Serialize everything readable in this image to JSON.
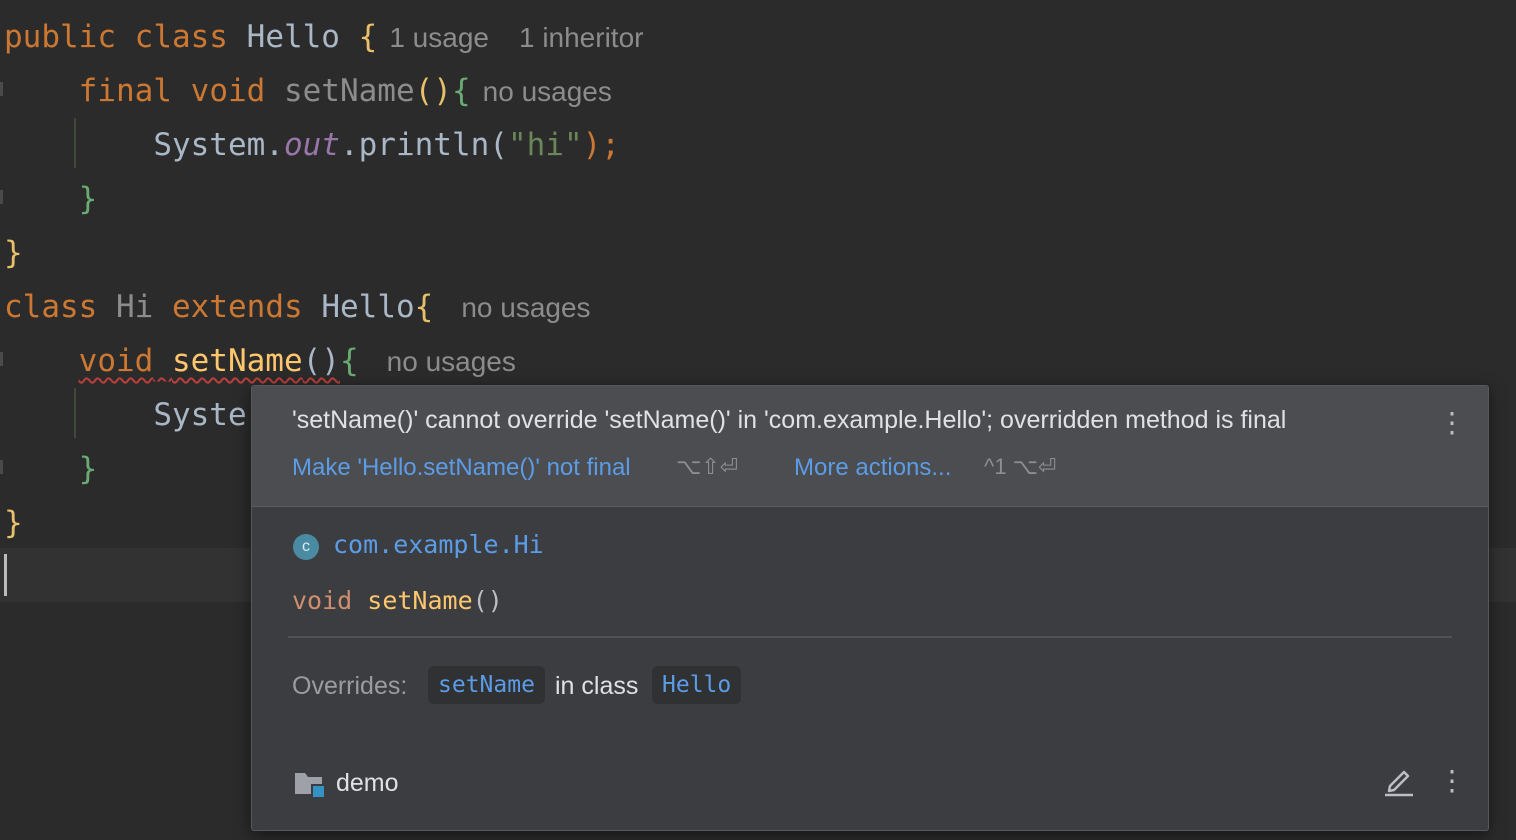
{
  "editor": {
    "line1": {
      "kw1": "public",
      "kw2": "class",
      "name": "Hello",
      "brace": "{",
      "hint1": "1 usage",
      "hint2": "1 inheritor"
    },
    "line2": {
      "kw1": "final",
      "kw2": "void",
      "fn": "setName",
      "parens": "()",
      "brace": "{",
      "hint": "no usages"
    },
    "line3": {
      "obj": "System.",
      "field": "out",
      "call": ".println(",
      "str": "\"hi\"",
      "end": ");"
    },
    "line4": {
      "brace": "}"
    },
    "line5": {
      "brace": "}"
    },
    "line6": {
      "kw1": "class",
      "name": "Hi",
      "kw2": "extends",
      "parent": "Hello",
      "brace": "{",
      "hint": "no usages"
    },
    "line7": {
      "kw": "void",
      "fn": "setName",
      "parens": "()",
      "brace": "{",
      "hint": "no usages"
    },
    "line8": {
      "text": "Syste"
    },
    "line9": {
      "brace": "}"
    },
    "line10": {
      "brace": "}"
    }
  },
  "popup": {
    "error_message": "'setName()' cannot override 'setName()' in 'com.example.Hello'; overridden method is final",
    "quick_fix_label": "Make 'Hello.setName()' not final",
    "quick_fix_shortcut": "⌥⇧⏎",
    "more_actions_label": "More actions...",
    "more_actions_shortcut": "^1 ⌥⏎",
    "class_icon_letter": "c",
    "qualified_name": "com.example.Hi",
    "signature": {
      "kw": "void",
      "fn": "setName",
      "parens": "()"
    },
    "overrides_label": "Overrides:",
    "overrides_method": "setName",
    "in_class_label": "in class",
    "overrides_class": "Hello",
    "module_name": "demo"
  },
  "icons": {
    "more": "vertical-dots-icon",
    "class": "class-icon",
    "folder": "module-folder-icon",
    "edit": "edit-pencil-icon"
  },
  "colors": {
    "editor_bg": "#2b2b2b",
    "keyword": "#cc7832",
    "method_decl": "#ffc66d",
    "link": "#5c9ce6",
    "error_squiggle": "#bc3f3c"
  }
}
